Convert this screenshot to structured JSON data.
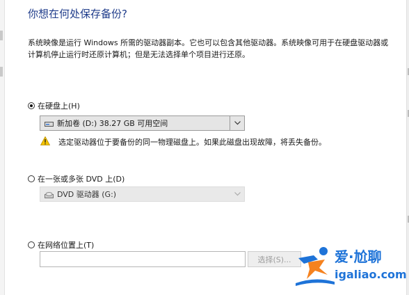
{
  "heading": "你想在何处保存备份?",
  "description": "系统映像是运行 Windows 所需的驱动器副本。它也可以包含其他驱动器。系统映像可用于在硬盘驱动器或计算机停止运行时还原计算机；但是无法选择单个项目进行还原。",
  "options": {
    "hard_disk": {
      "label": "在硬盘上(H)",
      "selected": true,
      "drive_value": "新加卷 (D:)  38.27 GB 可用空间",
      "warning": "选定驱动器位于要备份的同一物理磁盘上。如果此磁盘出现故障，将丢失备份。"
    },
    "dvd": {
      "label": "在一张或多张 DVD 上(D)",
      "selected": false,
      "drive_value": "DVD 驱动器 (G:)"
    },
    "network": {
      "label": "在网络位置上(T)",
      "selected": false,
      "path_value": "",
      "select_button": "选择(S)..."
    }
  },
  "watermark": {
    "brand": "爱·尬聊",
    "url": "igaliao.com"
  },
  "icons": {
    "radio": "radio-button",
    "drive": "hard-drive-icon",
    "dvd": "dvd-drive-icon",
    "warning": "warning-icon",
    "dropdown": "chevron-down-icon"
  },
  "colors": {
    "heading": "#1e3b8a",
    "warning_fill": "#f5c400",
    "watermark_blue": "#1e73d8",
    "watermark_orange": "#f5821f"
  }
}
